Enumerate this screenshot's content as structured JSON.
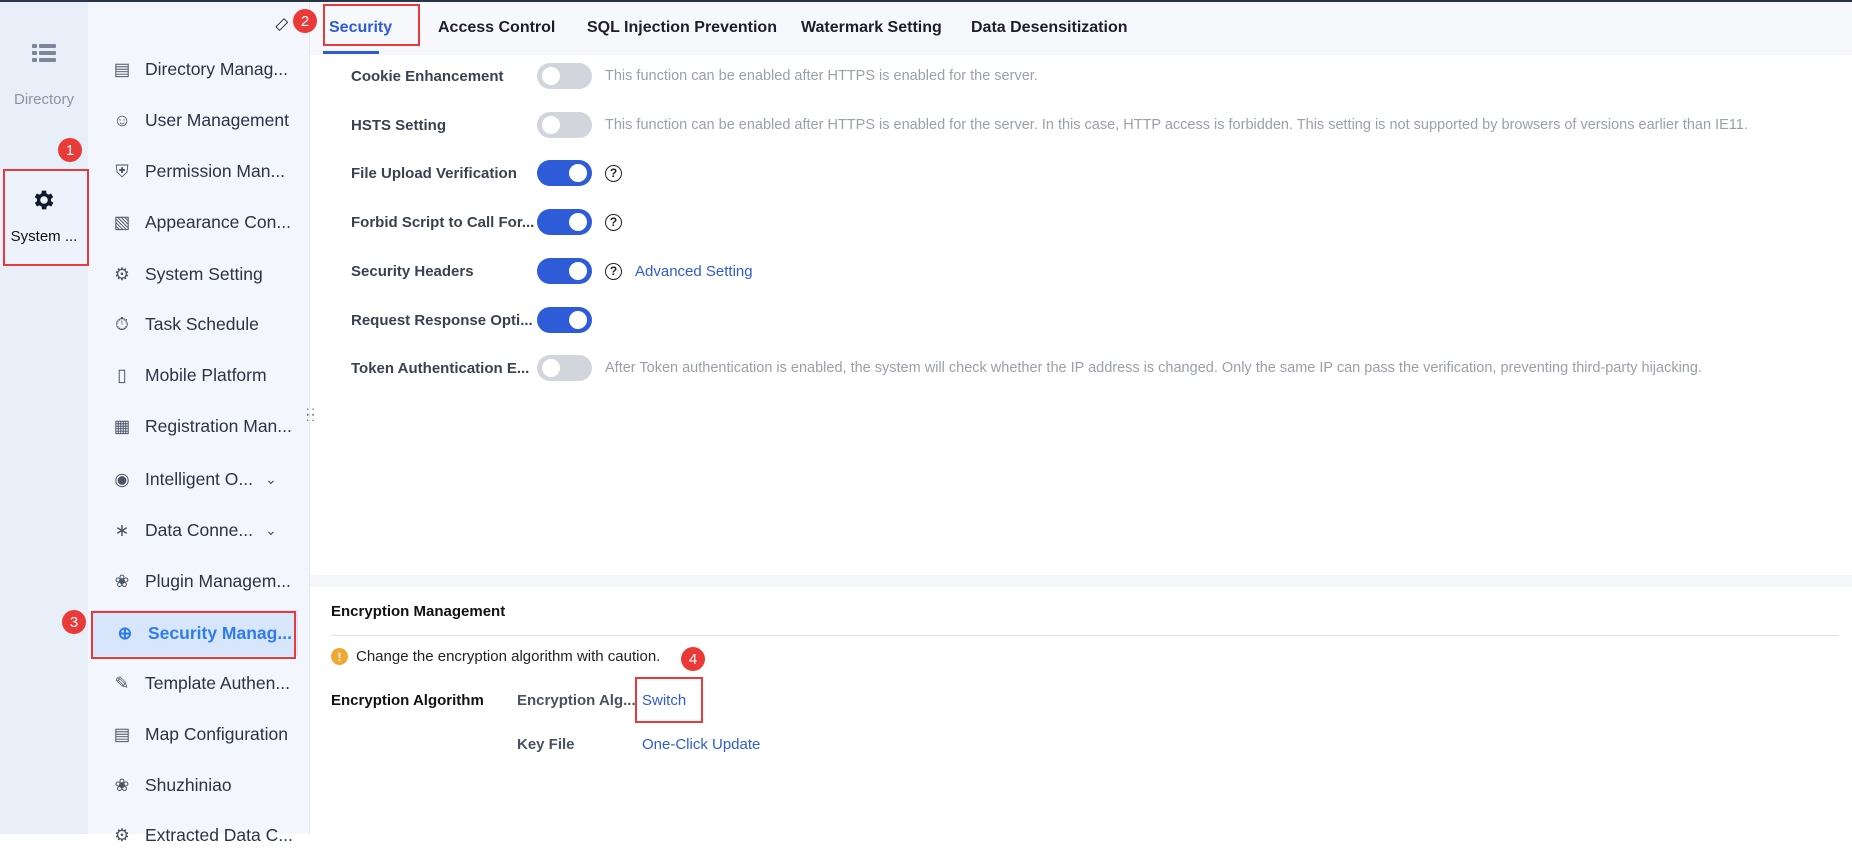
{
  "rail": {
    "items": [
      {
        "label": "Directory",
        "icon": "list-icon"
      },
      {
        "label": "System ...",
        "icon": "gear-icon"
      }
    ]
  },
  "nav": {
    "items": [
      {
        "label": "Directory Manag...",
        "icon": "directory-icon"
      },
      {
        "label": "User Management",
        "icon": "user-icon"
      },
      {
        "label": "Permission Man...",
        "icon": "permission-icon"
      },
      {
        "label": "Appearance Con...",
        "icon": "paint-roller-icon"
      },
      {
        "label": "System Setting",
        "icon": "settings-icon"
      },
      {
        "label": "Task Schedule",
        "icon": "timer-icon"
      },
      {
        "label": "Mobile Platform",
        "icon": "mobile-icon"
      },
      {
        "label": "Registration Man...",
        "icon": "registration-icon"
      },
      {
        "label": "Intelligent O...",
        "icon": "intelligent-ops-icon"
      },
      {
        "label": "Data Conne...",
        "icon": "paperclip-icon"
      },
      {
        "label": "Plugin Managem...",
        "icon": "puzzle-icon"
      },
      {
        "label": "Security Manag...",
        "icon": "shield-plus-icon"
      },
      {
        "label": "Template Authen...",
        "icon": "template-auth-icon"
      },
      {
        "label": "Map Configuration",
        "icon": "map-icon"
      },
      {
        "label": "Shuzhiniao",
        "icon": "puzzle-icon"
      },
      {
        "label": "Extracted Data C...",
        "icon": "gear-icon"
      }
    ]
  },
  "tabs": [
    "Security",
    "Access Control",
    "SQL Injection Prevention",
    "Watermark Setting",
    "Data Desensitization"
  ],
  "settings": [
    {
      "label": "Cookie Enhancement",
      "on": false,
      "desc": "This function can be enabled after HTTPS is enabled for the server."
    },
    {
      "label": "HSTS Setting",
      "on": false,
      "desc": "This function can be enabled after HTTPS is enabled for the server. In this case, HTTP access is forbidden. This setting is not supported by browsers of versions earlier than IE11."
    },
    {
      "label": "File Upload Verification",
      "on": true,
      "help": "?"
    },
    {
      "label": "Forbid Script to Call For...",
      "on": true,
      "help": "?"
    },
    {
      "label": "Security Headers",
      "on": true,
      "help": "?",
      "link": "Advanced Setting"
    },
    {
      "label": "Request Response Opti...",
      "on": true
    },
    {
      "label": "Token Authentication E...",
      "on": false,
      "desc": "After Token authentication is enabled, the system will check whether the IP address is changed. Only the same IP can pass the verification, preventing third-party hijacking."
    }
  ],
  "encryption": {
    "title": "Encryption Management",
    "warning": "Change the encryption algorithm with caution.",
    "algorithm_label": "Encryption Algorithm",
    "alg_field": "Encryption Alg...",
    "switch_link": "Switch",
    "key_file_label": "Key File",
    "update_link": "One-Click Update"
  },
  "badges": [
    "1",
    "2",
    "3",
    "4"
  ],
  "colors": {
    "accent": "#2e5bd8",
    "annotation": "#e8393b",
    "warning": "#f0a833"
  }
}
